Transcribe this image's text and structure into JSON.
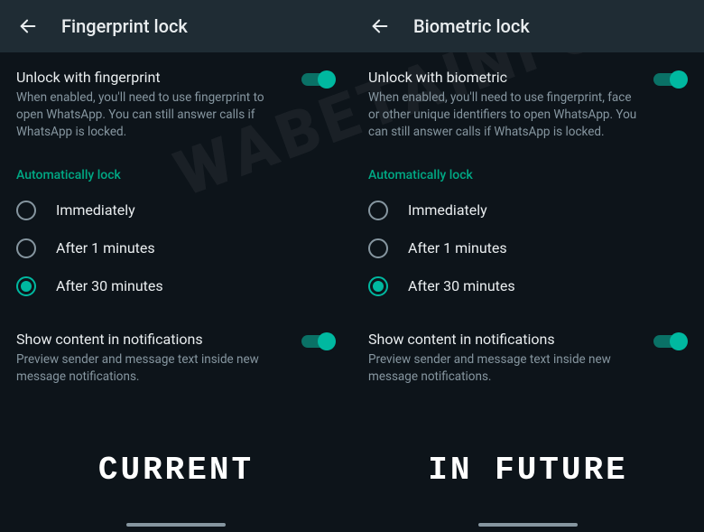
{
  "left": {
    "title": "Fingerprint lock",
    "unlock": {
      "title": "Unlock with fingerprint",
      "desc": "When enabled, you'll need to use fingerprint to open WhatsApp. You can still answer calls if WhatsApp is locked.",
      "enabled": true
    },
    "auto_lock_header": "Automatically lock",
    "options": [
      {
        "label": "Immediately",
        "selected": false
      },
      {
        "label": "After 1 minutes",
        "selected": false
      },
      {
        "label": "After 30 minutes",
        "selected": true
      }
    ],
    "show_content": {
      "title": "Show content in notifications",
      "desc": "Preview sender and message text inside new message notifications.",
      "enabled": true
    },
    "caption": "CURRENT"
  },
  "right": {
    "title": "Biometric lock",
    "unlock": {
      "title": "Unlock with biometric",
      "desc": "When enabled, you'll need to use fingerprint, face or other unique identifiers to open WhatsApp. You can still answer calls if WhatsApp is locked.",
      "enabled": true
    },
    "auto_lock_header": "Automatically lock",
    "options": [
      {
        "label": "Immediately",
        "selected": false
      },
      {
        "label": "After 1 minutes",
        "selected": false
      },
      {
        "label": "After 30 minutes",
        "selected": true
      }
    ],
    "show_content": {
      "title": "Show content in notifications",
      "desc": "Preview sender and message text inside new message notifications.",
      "enabled": true
    },
    "caption": "IN FUTURE"
  },
  "watermark": "WABETAINFO"
}
